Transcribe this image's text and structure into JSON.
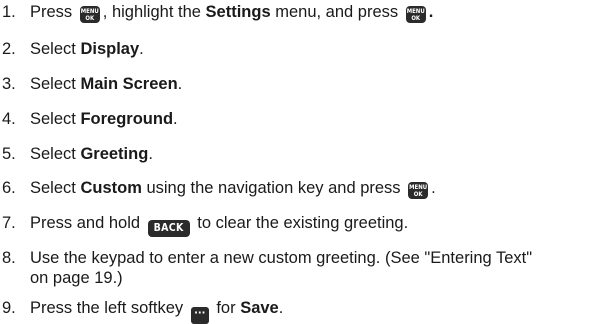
{
  "steps": [
    {
      "num": "1.",
      "t1": "Press",
      "k1": "MENU/OK",
      "t2": ", highlight the",
      "b1": "Settings",
      "t3": "menu, and press",
      "k2": "MENU/OK",
      "t4": "."
    },
    {
      "num": "2.",
      "t1": "Select",
      "b1": "Display",
      "t2": "."
    },
    {
      "num": "3.",
      "t1": "Select",
      "b1": "Main Screen",
      "t2": "."
    },
    {
      "num": "4.",
      "t1": "Select",
      "b1": "Foreground",
      "t2": "."
    },
    {
      "num": "5.",
      "t1": "Select",
      "b1": "Greeting",
      "t2": "."
    },
    {
      "num": "6.",
      "t1": "Select",
      "b1": "Custom",
      "t2": "using the navigation key and press",
      "k1": "MENU/OK",
      "t3": "."
    },
    {
      "num": "7.",
      "t1": "Press and hold",
      "k1": "BACK",
      "t2": "to clear the existing greeting."
    },
    {
      "num": "8.",
      "t1": "Use the keypad to enter a new custom greeting. (See \"Entering Text\" on page 19.)"
    },
    {
      "num": "9.",
      "t1": "Press the left softkey",
      "k1": "···",
      "t2": "for",
      "b1": "Save",
      "t3": "."
    }
  ],
  "keys": {
    "menu_top": "MENU",
    "menu_bottom": "OK",
    "back": "BACK",
    "softkey": "···"
  }
}
